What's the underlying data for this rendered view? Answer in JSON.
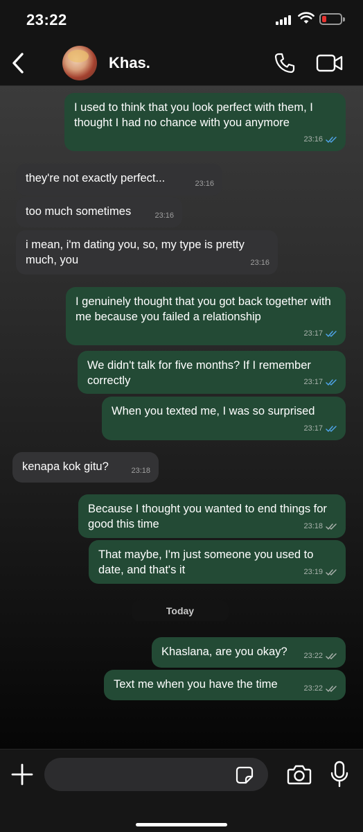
{
  "status": {
    "time": "23:22"
  },
  "header": {
    "contact_name": "Khas."
  },
  "messages": [
    {
      "dir": "out",
      "text": "I used to think that you look perfect with them, I thought I had no chance with you anymore",
      "time": "23:16",
      "read": true
    },
    {
      "dir": "in",
      "text": "they're not exactly perfect...",
      "time": "23:16"
    },
    {
      "dir": "in",
      "text": "too much sometimes",
      "time": "23:16"
    },
    {
      "dir": "in",
      "text": "i mean, i'm dating you, so, my type is pretty much, you",
      "time": "23:16"
    },
    {
      "dir": "out",
      "text": "I genuinely thought that you got back together with me because you failed a relationship",
      "time": "23:17",
      "read": true
    },
    {
      "dir": "out",
      "text": "We didn't talk for five months? If I remember correctly",
      "time": "23:17",
      "read": true
    },
    {
      "dir": "out",
      "text": "When you texted me, I was so surprised",
      "time": "23:17",
      "read": true
    },
    {
      "dir": "in",
      "text": "kenapa kok gitu?",
      "time": "23:18"
    },
    {
      "dir": "out",
      "text": "Because I thought you wanted to end things for good this time",
      "time": "23:18",
      "read": false
    },
    {
      "dir": "out",
      "text": "That maybe, I'm just someone you used to date, and that's it",
      "time": "23:19",
      "read": false
    },
    {
      "dir": "out",
      "text": "Khaslana, are you okay?",
      "time": "23:22",
      "read": false
    },
    {
      "dir": "out",
      "text": "Text me when you have the time",
      "time": "23:22",
      "read": false
    }
  ],
  "day_separator": "Today",
  "input": {
    "placeholder": ""
  },
  "colors": {
    "outgoing_bubble": "#234a35",
    "incoming_bubble": "#333335",
    "read_ticks": "#4fa3e8",
    "delivered_ticks": "#a9b0ab"
  }
}
